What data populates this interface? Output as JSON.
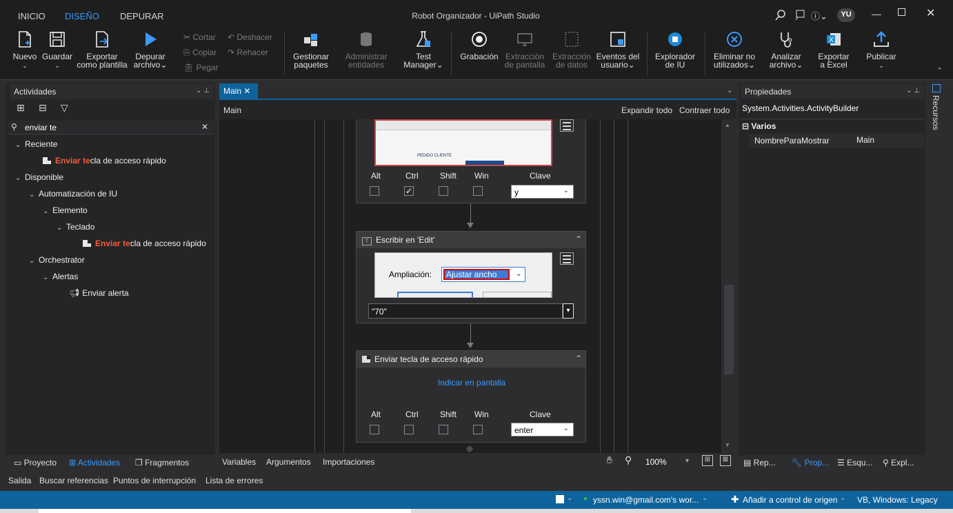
{
  "menu": {
    "tabs": [
      "INICIO",
      "DISEÑO",
      "DEPURAR"
    ],
    "active": "DISEÑO"
  },
  "window": {
    "title": "Robot Organizador - UiPath Studio",
    "user_initials": "YU"
  },
  "ribbon": {
    "nuevo": "Nuevo",
    "guardar": "Guardar",
    "exportar_l1": "Exportar",
    "exportar_l2": "como plantilla",
    "depurar_l1": "Depurar",
    "depurar_l2": "archivo",
    "cortar": "Cortar",
    "copiar": "Copiar",
    "pegar": "Pegar",
    "deshacer": "Deshacer",
    "rehacer": "Rehacer",
    "gestionar_l1": "Gestionar",
    "gestionar_l2": "paquetes",
    "admin_l1": "Administrar",
    "admin_l2": "entidades",
    "test_l1": "Test",
    "test_l2": "Manager",
    "grabacion": "Grabación",
    "extpant_l1": "Extracción",
    "extpant_l2": "de pantalla",
    "extdat_l1": "Extracción",
    "extdat_l2": "de datos",
    "eventos_l1": "Eventos del",
    "eventos_l2": "usuario",
    "explorador_l1": "Explorador",
    "explorador_l2": "de IU",
    "eliminar_l1": "Eliminar no",
    "eliminar_l2": "utilizados",
    "analizar_l1": "Analizar",
    "analizar_l2": "archivo",
    "excel_l1": "Exportar",
    "excel_l2": "a Excel",
    "publicar": "Publicar"
  },
  "activities_panel": {
    "title": "Actividades",
    "search_value": "enviar te",
    "tree": {
      "reciente": "Reciente",
      "item1_hl": "Enviar te",
      "item1_rest": "cla de acceso rápido",
      "disponible": "Disponible",
      "auto_iu": "Automatización de IU",
      "elemento": "Elemento",
      "teclado": "Teclado",
      "item2_hl": "Enviar te",
      "item2_rest": "cla de acceso rápido",
      "orchestrator": "Orchestrator",
      "alertas": "Alertas",
      "enviar_alerta": "Enviar alerta"
    },
    "bottom_tabs": [
      "Proyecto",
      "Actividades",
      "Fragmentos"
    ]
  },
  "designer": {
    "tab": "Main",
    "breadcrumb": "Main",
    "expand_all": "Expandir todo",
    "collapse_all": "Contraer todo",
    "keys": {
      "alt": "Alt",
      "ctrl": "Ctrl",
      "shift": "Shift",
      "win": "Win",
      "clave": "Clave"
    },
    "act1": {
      "ctrl_checked": true,
      "key_value": "y",
      "thumb_text": "PEDIDO CLIENTE"
    },
    "act2": {
      "title": "Escribir en 'Edit'",
      "label": "Ampliación:",
      "field_value": "Ajustar ancho",
      "text_value": "\"70\""
    },
    "act3": {
      "title": "Enviar tecla de acceso rápido",
      "indicate": "Indicar en pantalla",
      "key_value": "enter"
    },
    "bottom": {
      "variables": "Variables",
      "argumentos": "Argumentos",
      "importaciones": "Importaciones",
      "zoom": "100%"
    }
  },
  "properties_panel": {
    "title": "Propiedades",
    "type": "System.Activities.ActivityBuilder",
    "category": "Varios",
    "prop_name": "NombreParaMostrar",
    "prop_value": "Main",
    "side_tab": "Recursos",
    "bottom_tabs": [
      "Rep...",
      "Prop...",
      "Esqu...",
      "Expl..."
    ]
  },
  "output_tabs": [
    "Salida",
    "Buscar referencias",
    "Puntos de interrupción",
    "Lista de errores"
  ],
  "statusbar": {
    "account": "yssn.win@gmail.com's wor...",
    "source_control": "Añadir a control de origen",
    "lang": "VB, Windows: Legacy"
  },
  "colors": {
    "accent": "#0e639c",
    "highlight": "#f25c3a",
    "active_tab": "#3a9bfc"
  }
}
